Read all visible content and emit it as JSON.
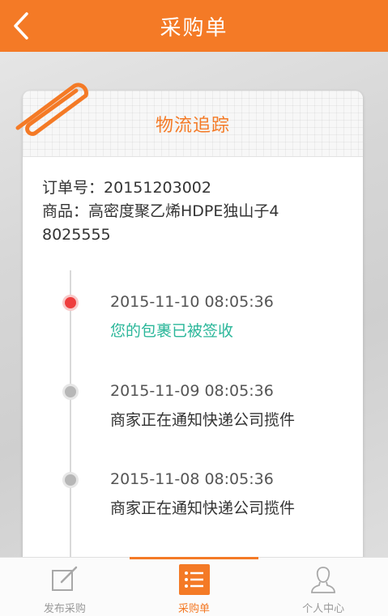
{
  "header": {
    "title": "采购单"
  },
  "card": {
    "title": "物流追踪",
    "order_label": "订单号：",
    "order_number": "20151203002",
    "product_label": "商品：",
    "product_name": "高密度聚乙烯HDPE独山子48025555"
  },
  "timeline": [
    {
      "time": "2015-11-10 08:05:36",
      "status": "您的包裹已被签收",
      "active": true
    },
    {
      "time": "2015-11-09 08:05:36",
      "status": "商家正在通知快递公司揽件",
      "active": false
    },
    {
      "time": "2015-11-08 08:05:36",
      "status": "商家正在通知快递公司揽件",
      "active": false
    }
  ],
  "bottom_nav": [
    {
      "label": "发布采购",
      "icon": "edit-icon",
      "active": false
    },
    {
      "label": "采购单",
      "icon": "list-icon",
      "active": true
    },
    {
      "label": "个人中心",
      "icon": "user-icon",
      "active": false
    }
  ],
  "colors": {
    "accent": "#f47a26",
    "success": "#2bb79a",
    "active_dot": "#ee3e3e"
  }
}
